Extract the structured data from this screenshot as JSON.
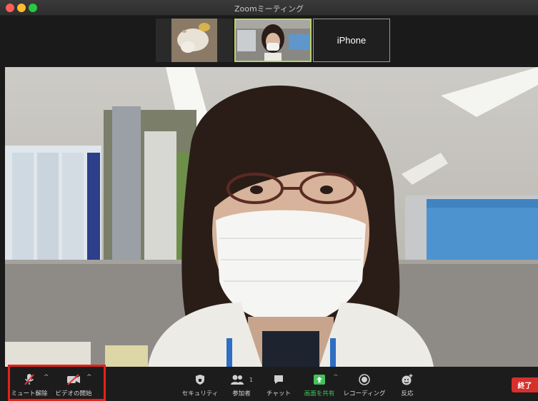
{
  "window": {
    "title": "Zoomミーティング"
  },
  "thumbnails": [
    {
      "label": ""
    },
    {
      "label": ""
    },
    {
      "label": "iPhone"
    }
  ],
  "toolbar": {
    "mute": "ミュート解除",
    "video": "ビデオの開始",
    "security": "セキュリティ",
    "participants": "参加者",
    "participants_count": "1",
    "chat": "チャット",
    "share": "画面を共有",
    "record": "レコーディング",
    "reactions": "反応",
    "end": "終了"
  },
  "colors": {
    "end_button": "#d5302c",
    "share_green": "#43c15b",
    "highlight": "#e8201a",
    "active_speaker_border": "#b9d36a"
  }
}
